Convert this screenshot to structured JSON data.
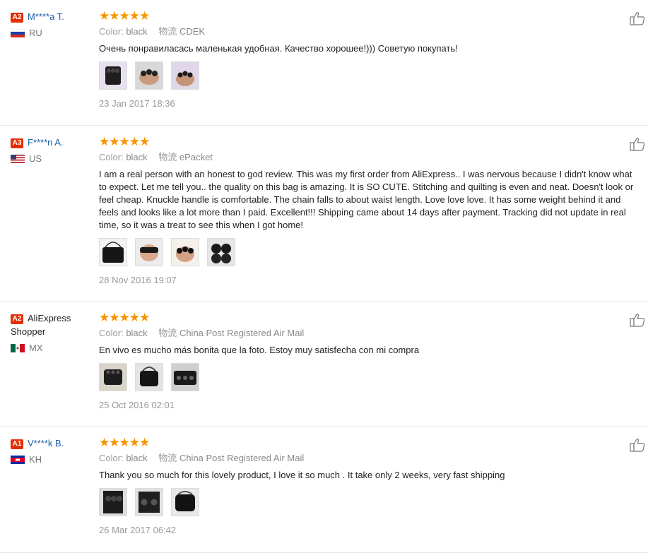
{
  "labels": {
    "color": "Color:",
    "logistics": "物流"
  },
  "reviews": [
    {
      "level": "A2",
      "name": "M****a T.",
      "name_line2": "",
      "country": "RU",
      "color": "black",
      "shipping": "CDEK",
      "text": "Очень понравиласась маленькая удобная. Качество хорошее!))) Советую покупать!",
      "date": "23 Jan 2017 18:36"
    },
    {
      "level": "A3",
      "name": "F****n A.",
      "name_line2": "",
      "country": "US",
      "color": "black",
      "shipping": "ePacket",
      "text": "I am a real person with an honest to god review. This was my first order from AliExpress.. I was nervous because I didn't know what\nto expect. Let me tell you.. the quality on this bag is amazing. It is SO CUTE. Stitching and quilting is even and neat. Doesn't look or\nfeel cheap. Knuckle handle is comfortable. The chain falls to about waist length. Love love love. It has some weight behind it and\nfeels and looks like a lot more than I paid. Excellent!!! Shipping came about 14 days after payment. Tracking did not update in real\ntime, so it was a treat to see this when I got home!",
      "date": "28 Nov 2016 19:07"
    },
    {
      "level": "A2",
      "name": "AliExpress",
      "name_line2": "Shopper",
      "country": "MX",
      "color": "black",
      "shipping": "China Post Registered Air Mail",
      "text": "En vivo es mucho más bonita que la foto. Estoy muy satisfecha con mi compra",
      "date": "25 Oct 2016 02:01"
    },
    {
      "level": "A1",
      "name": "V****k B.",
      "name_line2": "",
      "country": "KH",
      "color": "black",
      "shipping": "China Post Registered Air Mail",
      "text": "Thank you so much for this lovely product, I love it so much . It take only 2 weeks, very fast shipping",
      "date": "26 Mar 2017 06:42"
    }
  ],
  "stars_glyph": "★★★★★",
  "colors": {
    "star": "#f69400",
    "level_badge": "#e62e04",
    "username_link": "#1a5fa8"
  }
}
